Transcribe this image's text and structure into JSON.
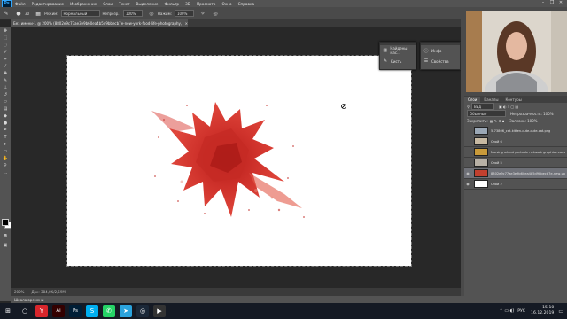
{
  "app": {
    "logo": "Ps"
  },
  "menu": {
    "items": [
      "Файл",
      "Редактирование",
      "Изображение",
      "Слои",
      "Текст",
      "Выделение",
      "Фильтр",
      "3D",
      "Просмотр",
      "Окно",
      "Справка"
    ],
    "window_buttons": [
      "–",
      "❐",
      "✕"
    ]
  },
  "options": {
    "brush_size": "30",
    "mode_label": "Режим:",
    "mode_value": "Нормальный",
    "opacity_label": "Непрозр.:",
    "opacity_value": "100%",
    "flow_label": "Нажим:",
    "flow_value": "100%"
  },
  "document": {
    "tab_title": "Без имени-1 @ 200% (8802e9c77ae3e9b60ea4b5d9bbecb7e-new-york-food-life-photography, RGB/8) *"
  },
  "status": {
    "zoom": "200%",
    "doc_info": "Док: 384,0K/2,59M"
  },
  "timeline": {
    "label": "Шкала времени"
  },
  "float_panels": {
    "swatch": [
      {
        "icon": "swatches-icon",
        "label": "Найдены мас..."
      },
      {
        "icon": "brush-icon",
        "label": "Кисть"
      }
    ],
    "info": [
      {
        "icon": "info-icon",
        "label": "Инфо"
      },
      {
        "icon": "properties-icon",
        "label": "Свойства"
      }
    ]
  },
  "layers_panel": {
    "tabs": [
      "Слои",
      "Каналы",
      "Контуры"
    ],
    "kind_label": "Вид",
    "blend_mode": "Обычные",
    "opacity": "Непрозрачность: 100%",
    "lock_label": "Закрепить:",
    "fill": "Заливка: 100%",
    "layers": [
      {
        "name": "5-73806_cat-kitten-cute-cute-cat.png",
        "visible": false,
        "thumb": "#9ba8b6",
        "selected": false
      },
      {
        "name": "Слой 6",
        "visible": false,
        "thumb": "#c7b9a2",
        "selected": false
      },
      {
        "name": "Nursing wheat portable network graphics ear-syro...",
        "visible": false,
        "thumb": "#c99a3a",
        "selected": false
      },
      {
        "name": "Слой 5",
        "visible": false,
        "thumb": "#b7b0a5",
        "selected": false
      },
      {
        "name": "8802e9c77ae3e9b60ea4b5d9bbecb7e-new-york-f...",
        "visible": true,
        "thumb": "#c2402f",
        "selected": true
      },
      {
        "name": "Слой 2",
        "visible": true,
        "thumb": "#ffffff",
        "selected": false
      }
    ]
  },
  "taskbar": {
    "apps": [
      {
        "icon": "start-icon",
        "glyph": "⊞",
        "color": "#151a24"
      },
      {
        "icon": "search-icon",
        "glyph": "○",
        "color": "#151a24"
      },
      {
        "icon": "yandex-browser-icon",
        "glyph": "Y",
        "color": "#d8262c"
      },
      {
        "icon": "illustrator-icon",
        "glyph": "Ai",
        "color": "#330000"
      },
      {
        "icon": "photoshop-icon",
        "glyph": "Ps",
        "color": "#001e36"
      },
      {
        "icon": "skype-icon",
        "glyph": "S",
        "color": "#00aff0"
      },
      {
        "icon": "whatsapp-icon",
        "glyph": "✆",
        "color": "#25d366"
      },
      {
        "icon": "telegram-icon",
        "glyph": "➤",
        "color": "#2aa3dd"
      },
      {
        "icon": "steam-icon",
        "glyph": "◎",
        "color": "#1b2838"
      },
      {
        "icon": "video-editor-icon",
        "glyph": "▶",
        "color": "#333333"
      }
    ],
    "lang": "РУС",
    "time": "15:10",
    "date": "16.12.2019"
  }
}
